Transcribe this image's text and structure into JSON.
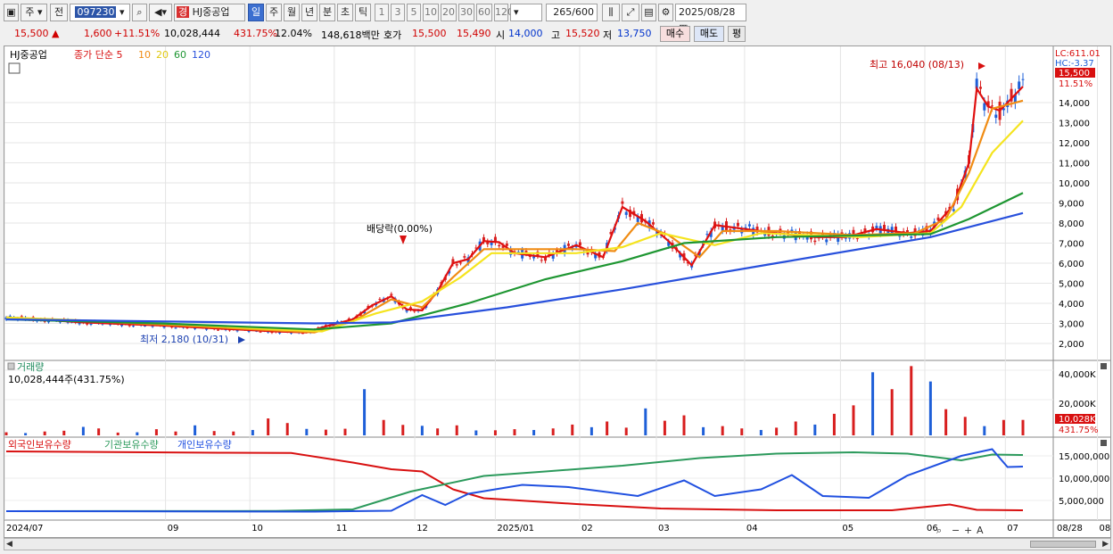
{
  "toolbar": {
    "period_type": "주",
    "prev_label": "전",
    "code": "097230",
    "stock_name": "HJ중공업",
    "tag": "경",
    "period_tabs": [
      "일",
      "주",
      "월",
      "년",
      "분",
      "초",
      "틱"
    ],
    "interval_buttons": [
      "1",
      "3",
      "5",
      "10",
      "20",
      "30",
      "60",
      "120"
    ],
    "count": "265",
    "count_max": "/600",
    "date": "2025/08/28"
  },
  "quote": {
    "price": "15,500",
    "change": "1,600",
    "change_pct": "+11.51%",
    "volume": "10,028,444",
    "volume_ratio": "431.75%",
    "turnover": "12.04%",
    "amount": "148,618백만",
    "ask_label": "호가",
    "ask": "15,500",
    "bid": "15,490",
    "open_label": "시",
    "open": "14,000",
    "high_label": "고",
    "high": "15,520",
    "low_label": "저",
    "low": "13,750",
    "buy_button": "매수",
    "sell_button": "매도",
    "eval_button": "평"
  },
  "price_panel": {
    "legend_name": "HJ중공업",
    "legend_ma_label": "종가 단순 5",
    "legend_ma": [
      "10",
      "20",
      "60",
      "120"
    ],
    "lc_label": "LC:611.01",
    "hc_label": "HC:-3.37",
    "last_price_tag": "15,500",
    "last_pct_tag": "11.51%",
    "high_annotation": "최고 16,040 (08/13)",
    "low_annotation": "최저 2,180 (10/31)",
    "dividend_annotation": "배당락(0.00%)"
  },
  "volume_panel": {
    "title": "거래량",
    "current": "10,028,444주(431.75%)",
    "ticks": [
      "40,000K",
      "20,000K"
    ],
    "last_tag": "10,028K",
    "last_pct_tag": "431.75%"
  },
  "holdings_panel": {
    "legend": [
      "외국인보유수량",
      "기관보유수량",
      "개인보유수량"
    ],
    "ticks": [
      "15,000,000",
      "10,000,000",
      "5,000,000"
    ]
  },
  "x_axis": {
    "labels": [
      "2024/07",
      "09",
      "10",
      "11",
      "12",
      "2025/01",
      "02",
      "03",
      "04",
      "05",
      "06",
      "07",
      "08"
    ],
    "current": "08/28"
  },
  "colors": {
    "up": "#d81e1e",
    "down": "#1e5fd8",
    "ma5": "#e01010",
    "ma10": "#f08c14",
    "ma20": "#f5e41e",
    "ma60": "#1e9632",
    "ma120": "#2850dc",
    "foreign": "#d81010",
    "institution": "#2c9a5c",
    "individual": "#2050e0"
  },
  "chart_data": {
    "type": "line",
    "title": "HJ중공업",
    "price_axis": [
      2000,
      3000,
      4000,
      5000,
      6000,
      7000,
      8000,
      9000,
      10000,
      11000,
      12000,
      13000,
      14000
    ],
    "series": [
      {
        "name": "종가 단순 5",
        "points": [
          [
            0,
            3300
          ],
          [
            20,
            3050
          ],
          [
            40,
            2900
          ],
          [
            60,
            2700
          ],
          [
            70,
            2600
          ],
          [
            78,
            2550
          ],
          [
            82,
            2800
          ],
          [
            90,
            3200
          ],
          [
            95,
            3900
          ],
          [
            100,
            4350
          ],
          [
            104,
            3700
          ],
          [
            108,
            3650
          ],
          [
            112,
            4600
          ],
          [
            116,
            6000
          ],
          [
            120,
            6200
          ],
          [
            124,
            7100
          ],
          [
            128,
            7050
          ],
          [
            132,
            6500
          ],
          [
            140,
            6300
          ],
          [
            148,
            6900
          ],
          [
            155,
            6300
          ],
          [
            160,
            8800
          ],
          [
            166,
            8100
          ],
          [
            172,
            7100
          ],
          [
            178,
            5900
          ],
          [
            184,
            7900
          ],
          [
            192,
            7700
          ],
          [
            200,
            7500
          ],
          [
            210,
            7300
          ],
          [
            218,
            7300
          ],
          [
            226,
            7700
          ],
          [
            234,
            7500
          ],
          [
            240,
            7600
          ],
          [
            246,
            8900
          ],
          [
            250,
            11000
          ],
          [
            252,
            14700
          ],
          [
            255,
            13800
          ],
          [
            258,
            13600
          ],
          [
            260,
            14000
          ],
          [
            264,
            14800
          ]
        ]
      },
      {
        "name": "10",
        "points": [
          [
            0,
            3300
          ],
          [
            40,
            2950
          ],
          [
            70,
            2650
          ],
          [
            80,
            2550
          ],
          [
            90,
            3100
          ],
          [
            100,
            4200
          ],
          [
            108,
            3800
          ],
          [
            116,
            5300
          ],
          [
            124,
            6700
          ],
          [
            132,
            6700
          ],
          [
            148,
            6700
          ],
          [
            158,
            6600
          ],
          [
            164,
            8000
          ],
          [
            172,
            7400
          ],
          [
            180,
            6300
          ],
          [
            186,
            7600
          ],
          [
            200,
            7600
          ],
          [
            220,
            7400
          ],
          [
            236,
            7500
          ],
          [
            244,
            8200
          ],
          [
            250,
            10500
          ],
          [
            256,
            13700
          ],
          [
            264,
            14100
          ]
        ]
      },
      {
        "name": "20",
        "points": [
          [
            0,
            3300
          ],
          [
            40,
            3000
          ],
          [
            70,
            2700
          ],
          [
            82,
            2600
          ],
          [
            96,
            3500
          ],
          [
            108,
            4100
          ],
          [
            118,
            5300
          ],
          [
            126,
            6500
          ],
          [
            148,
            6500
          ],
          [
            160,
            6800
          ],
          [
            170,
            7500
          ],
          [
            184,
            6900
          ],
          [
            196,
            7500
          ],
          [
            222,
            7300
          ],
          [
            240,
            7500
          ],
          [
            248,
            8800
          ],
          [
            256,
            11500
          ],
          [
            264,
            13100
          ]
        ]
      },
      {
        "name": "60",
        "points": [
          [
            0,
            3200
          ],
          [
            40,
            3000
          ],
          [
            80,
            2700
          ],
          [
            100,
            3000
          ],
          [
            120,
            4000
          ],
          [
            140,
            5200
          ],
          [
            160,
            6100
          ],
          [
            176,
            7000
          ],
          [
            200,
            7300
          ],
          [
            240,
            7450
          ],
          [
            250,
            8200
          ],
          [
            264,
            9500
          ]
        ]
      },
      {
        "name": "120",
        "points": [
          [
            0,
            3200
          ],
          [
            80,
            3000
          ],
          [
            100,
            3050
          ],
          [
            130,
            3800
          ],
          [
            160,
            4700
          ],
          [
            200,
            6000
          ],
          [
            240,
            7300
          ],
          [
            264,
            8500
          ]
        ]
      }
    ],
    "volume_k": [
      2000,
      1500,
      2500,
      3000,
      5500,
      4500,
      1800,
      2000,
      4000,
      2500,
      6500,
      2800,
      2500,
      3500,
      11000,
      8000,
      4200,
      3700,
      4300,
      30000,
      10000,
      6800,
      6200,
      4500,
      6500,
      3200,
      3300,
      4000,
      3500,
      4500,
      7000,
      5300,
      9000,
      5000,
      17500,
      9500,
      13000,
      5300,
      6000,
      4500,
      3500,
      5000,
      9000,
      7000,
      14000,
      19500,
      41000,
      30000,
      45000,
      35000,
      17000,
      12000,
      6000,
      10000,
      10028
    ],
    "holdings": [
      {
        "name": "외국인보유수량",
        "points": [
          [
            0,
            16000
          ],
          [
            55,
            15700
          ],
          [
            74,
            15650
          ],
          [
            90,
            13500
          ],
          [
            100,
            12000
          ],
          [
            108,
            11500
          ],
          [
            116,
            7500
          ],
          [
            124,
            5500
          ],
          [
            148,
            4200
          ],
          [
            170,
            3200
          ],
          [
            200,
            2800
          ],
          [
            230,
            2800
          ],
          [
            245,
            4100
          ],
          [
            252,
            2900
          ],
          [
            264,
            2800
          ]
        ]
      },
      {
        "name": "기관보유수량",
        "points": [
          [
            0,
            2600
          ],
          [
            70,
            2650
          ],
          [
            90,
            3000
          ],
          [
            105,
            7000
          ],
          [
            124,
            10500
          ],
          [
            140,
            11500
          ],
          [
            160,
            12800
          ],
          [
            180,
            14500
          ],
          [
            200,
            15500
          ],
          [
            220,
            15800
          ],
          [
            234,
            15500
          ],
          [
            248,
            14000
          ],
          [
            256,
            15300
          ],
          [
            264,
            15200
          ]
        ]
      },
      {
        "name": "개인보유수량",
        "points": [
          [
            0,
            2600
          ],
          [
            80,
            2500
          ],
          [
            100,
            2700
          ],
          [
            108,
            6200
          ],
          [
            114,
            4000
          ],
          [
            120,
            6500
          ],
          [
            134,
            8500
          ],
          [
            146,
            8000
          ],
          [
            164,
            6000
          ],
          [
            176,
            9500
          ],
          [
            184,
            6000
          ],
          [
            196,
            7500
          ],
          [
            204,
            10700
          ],
          [
            212,
            6000
          ],
          [
            224,
            5600
          ],
          [
            234,
            10600
          ],
          [
            248,
            15000
          ],
          [
            256,
            16500
          ],
          [
            260,
            12500
          ],
          [
            264,
            12600
          ]
        ]
      }
    ]
  }
}
